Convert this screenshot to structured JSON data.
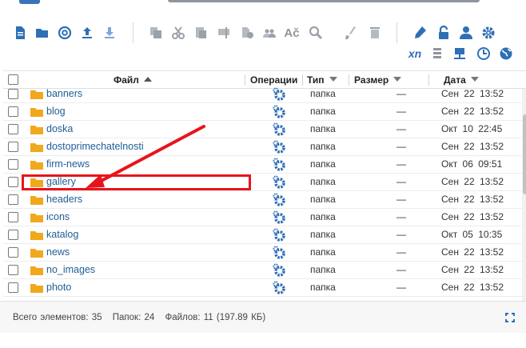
{
  "toolbar": {
    "icons": [
      "new-file-icon",
      "open-folder-icon",
      "at-icon",
      "upload-icon",
      "download-icon",
      "copy-icon",
      "cut-icon",
      "paste-icon",
      "rename-icon",
      "duplicate-icon",
      "users-icon",
      "text-icon",
      "search-icon",
      "clean-icon",
      "trash-icon",
      "edit-icon",
      "unlock-icon",
      "user-icon",
      "gear-icon",
      "xn-icon",
      "list-icon",
      "network-icon",
      "clock-icon",
      "globe-icon"
    ],
    "xn_label": "xn"
  },
  "table": {
    "headers": {
      "name": "Файл",
      "ops": "Операции",
      "type": "Тип",
      "size": "Размер",
      "date": "Дата"
    },
    "rows": [
      {
        "name": "banners",
        "type": "папка",
        "size": "—",
        "date": "Сен 22 13:52"
      },
      {
        "name": "blog",
        "type": "папка",
        "size": "—",
        "date": "Сен 22 13:52"
      },
      {
        "name": "doska",
        "type": "папка",
        "size": "—",
        "date": "Окт 10 22:45"
      },
      {
        "name": "dostoprimechatelnosti",
        "type": "папка",
        "size": "—",
        "date": "Сен 22 13:52"
      },
      {
        "name": "firm-news",
        "type": "папка",
        "size": "—",
        "date": "Окт 06 09:51"
      },
      {
        "name": "gallery",
        "type": "папка",
        "size": "—",
        "date": "Сен 22 13:52"
      },
      {
        "name": "headers",
        "type": "папка",
        "size": "—",
        "date": "Сен 22 13:52"
      },
      {
        "name": "icons",
        "type": "папка",
        "size": "—",
        "date": "Сен 22 13:52"
      },
      {
        "name": "katalog",
        "type": "папка",
        "size": "—",
        "date": "Окт 05 10:35"
      },
      {
        "name": "news",
        "type": "папка",
        "size": "—",
        "date": "Сен 22 13:52"
      },
      {
        "name": "no_images",
        "type": "папка",
        "size": "—",
        "date": "Сен 22 13:52"
      },
      {
        "name": "photo",
        "type": "папка",
        "size": "—",
        "date": "Сен 22 13:52"
      }
    ]
  },
  "status": {
    "total": "Всего элементов: 35",
    "folders": "Папок: 24",
    "files": "Файлов: 11 (197.89 КБ)"
  },
  "colors": {
    "icon_blue": "#2f6fb5",
    "icon_gray": "#b4bac1",
    "folder": "#f0a81c",
    "link": "#1f5e96",
    "annotation_red": "#e8141c"
  }
}
